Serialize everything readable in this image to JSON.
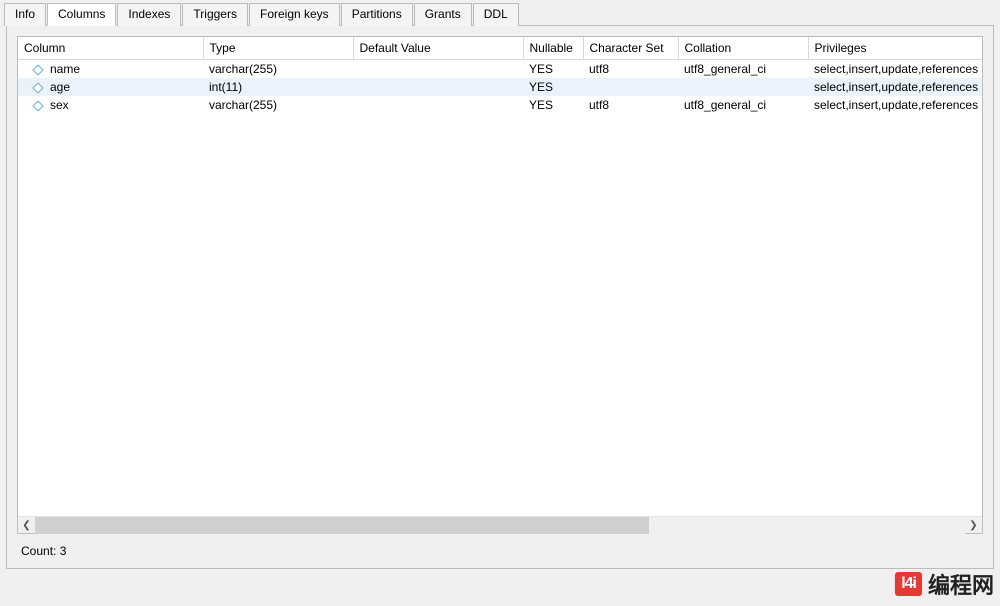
{
  "tabs": {
    "info": "Info",
    "columns": "Columns",
    "indexes": "Indexes",
    "triggers": "Triggers",
    "foreign_keys": "Foreign keys",
    "partitions": "Partitions",
    "grants": "Grants",
    "ddl": "DDL",
    "active": "columns"
  },
  "headers": {
    "column": "Column",
    "type": "Type",
    "default_value": "Default Value",
    "nullable": "Nullable",
    "character_set": "Character Set",
    "collation": "Collation",
    "privileges": "Privileges"
  },
  "rows": [
    {
      "column": "name",
      "type": "varchar(255)",
      "default_value": "",
      "nullable": "YES",
      "character_set": "utf8",
      "collation": "utf8_general_ci",
      "privileges": "select,insert,update,references",
      "selected": false
    },
    {
      "column": "age",
      "type": "int(11)",
      "default_value": "",
      "nullable": "YES",
      "character_set": "",
      "collation": "",
      "privileges": "select,insert,update,references",
      "selected": true
    },
    {
      "column": "sex",
      "type": "varchar(255)",
      "default_value": "",
      "nullable": "YES",
      "character_set": "utf8",
      "collation": "utf8_general_ci",
      "privileges": "select,insert,update,references",
      "selected": false
    }
  ],
  "status": {
    "count_label": "Count:",
    "count_value": "3"
  },
  "watermark": {
    "badge": "l4i",
    "text": "编程网"
  }
}
